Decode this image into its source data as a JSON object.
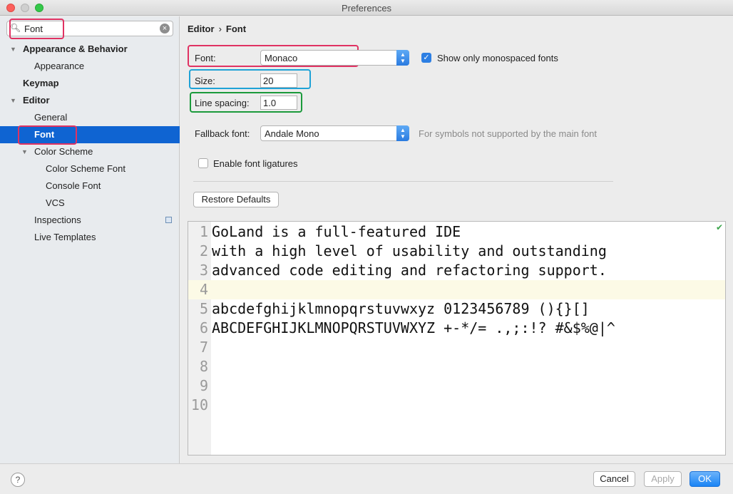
{
  "window": {
    "title": "Preferences"
  },
  "search": {
    "value": "Font"
  },
  "sidebar": {
    "items": [
      {
        "label": "Appearance & Behavior"
      },
      {
        "label": "Appearance"
      },
      {
        "label": "Keymap"
      },
      {
        "label": "Editor"
      },
      {
        "label": "General"
      },
      {
        "label": "Font"
      },
      {
        "label": "Color Scheme"
      },
      {
        "label": "Color Scheme Font"
      },
      {
        "label": "Console Font"
      },
      {
        "label": "VCS"
      },
      {
        "label": "Inspections"
      },
      {
        "label": "Live Templates"
      }
    ]
  },
  "breadcrumb": {
    "parent": "Editor",
    "separator": "›",
    "current": "Font"
  },
  "font": {
    "label": "Font:",
    "value": "Monaco",
    "monospaced_label": "Show only monospaced fonts",
    "monospaced_checked": true,
    "size_label": "Size:",
    "size_value": "20",
    "line_spacing_label": "Line spacing:",
    "line_spacing_value": "1.0",
    "fallback_label": "Fallback font:",
    "fallback_value": "Andale Mono",
    "fallback_note": "For symbols not supported by the main font",
    "ligatures_label": "Enable font ligatures",
    "ligatures_checked": false,
    "restore_label": "Restore Defaults"
  },
  "preview": {
    "lines": [
      {
        "num": "1",
        "text": "GoLand is a full-featured IDE"
      },
      {
        "num": "2",
        "text": "with a high level of usability and outstanding"
      },
      {
        "num": "3",
        "text": "advanced code editing and refactoring support."
      },
      {
        "num": "4",
        "text": ""
      },
      {
        "num": "5",
        "text": "abcdefghijklmnopqrstuvwxyz 0123456789 (){}[]"
      },
      {
        "num": "6",
        "text": "ABCDEFGHIJKLMNOPQRSTUVWXYZ +-*/= .,;:!? #&$%@|^"
      },
      {
        "num": "7",
        "text": ""
      },
      {
        "num": "8",
        "text": ""
      },
      {
        "num": "9",
        "text": ""
      },
      {
        "num": "10",
        "text": ""
      }
    ]
  },
  "footer": {
    "help": "?",
    "cancel": "Cancel",
    "apply": "Apply",
    "ok": "OK"
  },
  "colors": {
    "selection": "#0f64d2",
    "highlight_red": "#e03262",
    "highlight_blue": "#1fa2d6",
    "highlight_green": "#1b9a3b",
    "caret_row": "#fcfae6"
  },
  "icons": [
    "search-icon",
    "clear-icon",
    "chevron-down-icon",
    "checkmark-icon",
    "copy-icon",
    "help-icon",
    "stepper-icon"
  ]
}
